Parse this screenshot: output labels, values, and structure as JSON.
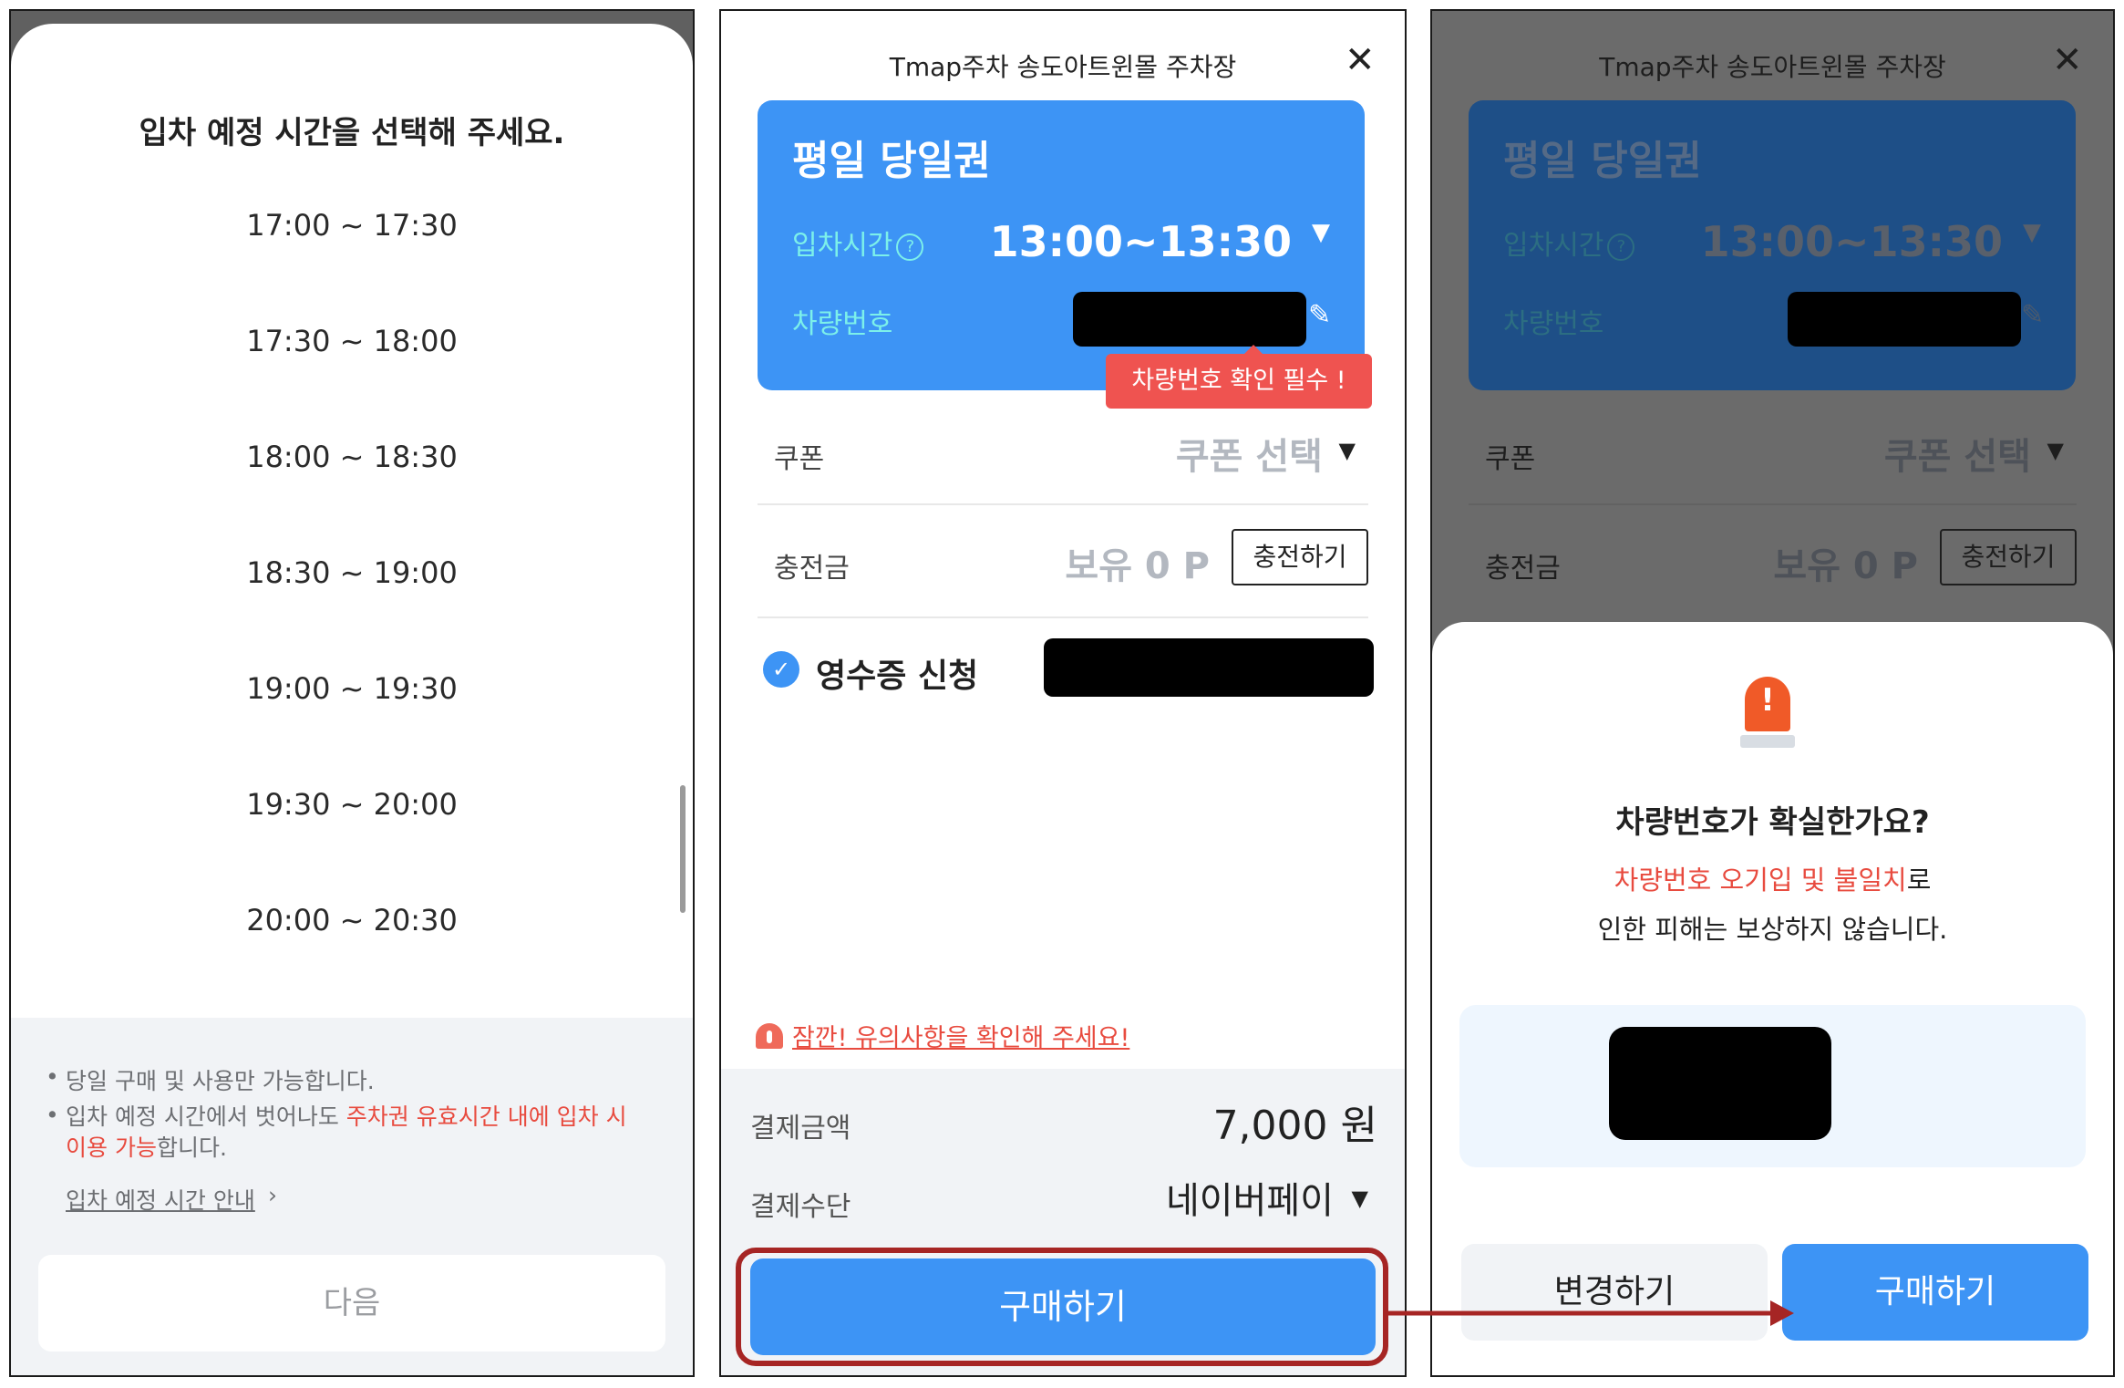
{
  "screen1": {
    "title": "입차 예정 시간을 선택해 주세요.",
    "time_slots": [
      "17:00 ~ 17:30",
      "17:30 ~ 18:00",
      "18:00 ~ 18:30",
      "18:30 ~ 19:00",
      "19:00 ~ 19:30",
      "19:30 ~ 20:00",
      "20:00 ~ 20:30"
    ],
    "notice_1": "당일 구매 및 사용만 가능합니다.",
    "notice_2_a": "입차 예정 시간에서 벗어나도 ",
    "notice_2_red": "주차권 유효시간 내에 입차 시",
    "notice_2_red2": "이용 가능",
    "notice_2_b": "합니다.",
    "guide_link": "입차 예정 시간 안내",
    "next_button": "다음"
  },
  "screen2": {
    "header": "Tmap주차 송도아트윈몰 주차장",
    "ticket_name": "평일 당일권",
    "entry_time_label": "입차시간",
    "entry_time_value": "13:00~13:30",
    "plate_label": "차량번호",
    "plate_tooltip": "차량번호 확인 필수 !",
    "coupon_label": "쿠폰",
    "coupon_value": "쿠폰 선택",
    "balance_label": "충전금",
    "balance_value": "보유 0 P",
    "charge_button": "충전하기",
    "receipt_label": "영수증 신청",
    "warning_text": "잠깐! 유의사항을 확인해 주세요!",
    "amount_label": "결제금액",
    "amount_value": "7,000 원",
    "method_label": "결제수단",
    "method_value": "네이버페이",
    "buy_button": "구매하기"
  },
  "screen3": {
    "header": "Tmap주차 송도아트윈몰 주차장",
    "ticket_name": "평일 당일권",
    "entry_time_label": "입차시간",
    "entry_time_value": "13:00~13:30",
    "plate_label": "차량번호",
    "coupon_label": "쿠폰",
    "coupon_value": "쿠폰 선택",
    "balance_label": "충전금",
    "balance_value": "보유 0 P",
    "charge_button": "충전하기",
    "confirm_title": "차량번호가 확실한가요?",
    "confirm_msg_red": "차량번호 오기입 및 불일치",
    "confirm_msg_tail": "로",
    "confirm_msg_2": "인한 피해는 보상하지 않습니다.",
    "change_button": "변경하기",
    "buy_button": "구매하기"
  },
  "colors": {
    "primary_blue": "#3d94f5",
    "accent_red": "#e84b3f",
    "highlight_box": "#a62524"
  },
  "icons": [
    "close-icon",
    "help-icon",
    "caret-down-icon",
    "pencil-icon",
    "check-icon",
    "siren-icon",
    "chevron-right-icon",
    "arrow-right-icon"
  ]
}
